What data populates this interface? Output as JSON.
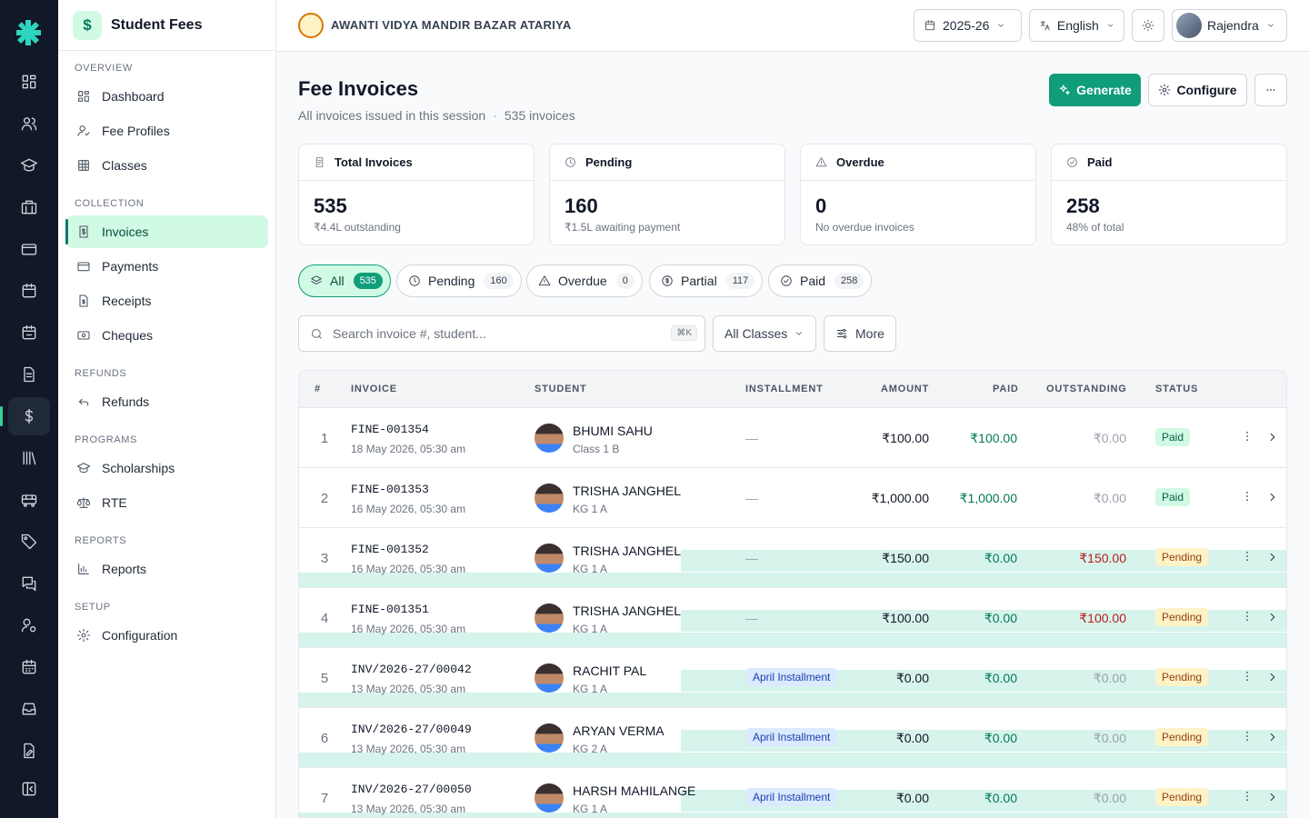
{
  "app": {
    "title": "Student Fees",
    "logo_glyph": "$"
  },
  "rail": {
    "items": [
      "dashboard-icon",
      "users-icon",
      "graduation-cap-icon",
      "building-icon",
      "credit-card-icon",
      "calendar-icon",
      "calendar-check-icon",
      "file-text-icon",
      "dollar-icon",
      "library-icon",
      "bus-icon",
      "tag-icon",
      "messages-icon",
      "user-cog-icon",
      "calendar-grid-icon",
      "inbox-icon",
      "file-edit-icon",
      "collapse-icon"
    ],
    "active": "dollar-icon"
  },
  "sidebar": {
    "sections": {
      "overview": "OVERVIEW",
      "collection": "COLLECTION",
      "refunds": "REFUNDS",
      "programs": "PROGRAMS",
      "reports": "REPORTS",
      "setup": "SETUP"
    },
    "items": {
      "dashboard": "Dashboard",
      "fee_profiles": "Fee Profiles",
      "classes": "Classes",
      "invoices": "Invoices",
      "payments": "Payments",
      "receipts": "Receipts",
      "cheques": "Cheques",
      "refunds": "Refunds",
      "scholarships": "Scholarships",
      "rte": "RTE",
      "reports": "Reports",
      "configuration": "Configuration"
    },
    "active": "invoices"
  },
  "topbar": {
    "school_name": "AWANTI VIDYA MANDIR BAZAR ATARIYA",
    "session": "2025-26",
    "language": "English",
    "user": "Rajendra"
  },
  "page": {
    "title": "Fee Invoices",
    "subtitle": "All invoices issued in this session",
    "count": "535 invoices",
    "generate_label": "Generate",
    "configure_label": "Configure"
  },
  "stats": {
    "total": {
      "label": "Total Invoices",
      "value": "535",
      "sub": "₹4.4L outstanding"
    },
    "pending": {
      "label": "Pending",
      "value": "160",
      "sub": "₹1.5L awaiting payment"
    },
    "overdue": {
      "label": "Overdue",
      "value": "0",
      "sub": "No overdue invoices"
    },
    "paid": {
      "label": "Paid",
      "value": "258",
      "sub": "48% of total"
    }
  },
  "filters": {
    "all": {
      "label": "All",
      "count": "535"
    },
    "pending": {
      "label": "Pending",
      "count": "160"
    },
    "overdue": {
      "label": "Overdue",
      "count": "0"
    },
    "partial": {
      "label": "Partial",
      "count": "117"
    },
    "paid": {
      "label": "Paid",
      "count": "258"
    },
    "active": "all"
  },
  "search": {
    "placeholder": "Search invoice #, student...",
    "shortcut": "⌘K"
  },
  "class_filter": "All Classes",
  "more_label": "More",
  "table": {
    "headers": {
      "num": "#",
      "invoice": "INVOICE",
      "student": "STUDENT",
      "installment": "INSTALLMENT",
      "amount": "AMOUNT",
      "paid": "PAID",
      "outstanding": "OUTSTANDING",
      "status": "STATUS"
    },
    "rows": [
      {
        "num": "1",
        "invoice": "FINE-001354",
        "date": "18 May 2026, 05:30 am",
        "student": "BHUMI SAHU",
        "class": "Class 1 B",
        "installment": "—",
        "amount": "₹100.00",
        "paid": "₹100.00",
        "outstanding": "₹0.00",
        "status": "Paid"
      },
      {
        "num": "2",
        "invoice": "FINE-001353",
        "date": "16 May 2026, 05:30 am",
        "student": "TRISHA JANGHEL",
        "class": "KG 1 A",
        "installment": "—",
        "amount": "₹1,000.00",
        "paid": "₹1,000.00",
        "outstanding": "₹0.00",
        "status": "Paid"
      },
      {
        "num": "3",
        "invoice": "FINE-001352",
        "date": "16 May 2026, 05:30 am",
        "student": "TRISHA JANGHEL",
        "class": "KG 1 A",
        "installment": "—",
        "amount": "₹150.00",
        "paid": "₹0.00",
        "outstanding": "₹150.00",
        "status": "Pending"
      },
      {
        "num": "4",
        "invoice": "FINE-001351",
        "date": "16 May 2026, 05:30 am",
        "student": "TRISHA JANGHEL",
        "class": "KG 1 A",
        "installment": "—",
        "amount": "₹100.00",
        "paid": "₹0.00",
        "outstanding": "₹100.00",
        "status": "Pending"
      },
      {
        "num": "5",
        "invoice": "INV/2026-27/00042",
        "date": "13 May 2026, 05:30 am",
        "student": "RACHIT PAL",
        "class": "KG 1 A",
        "installment": "April Installment",
        "amount": "₹0.00",
        "paid": "₹0.00",
        "outstanding": "₹0.00",
        "status": "Pending"
      },
      {
        "num": "6",
        "invoice": "INV/2026-27/00049",
        "date": "13 May 2026, 05:30 am",
        "student": "ARYAN VERMA",
        "class": "KG 2 A",
        "installment": "April Installment",
        "amount": "₹0.00",
        "paid": "₹0.00",
        "outstanding": "₹0.00",
        "status": "Pending"
      },
      {
        "num": "7",
        "invoice": "INV/2026-27/00050",
        "date": "13 May 2026, 05:30 am",
        "student": "HARSH MAHILANGE",
        "class": "KG 1 A",
        "installment": "April Installment",
        "amount": "₹0.00",
        "paid": "₹0.00",
        "outstanding": "₹0.00",
        "status": "Pending"
      }
    ]
  },
  "colors": {
    "accent": "#0f9d7a",
    "sidebar_active_bg": "#d1fae5",
    "rail_bg": "#111827",
    "pending_bg": "#fef3c7",
    "paid_bg": "#d1fae5",
    "outstanding_due": "#b91c1c"
  }
}
